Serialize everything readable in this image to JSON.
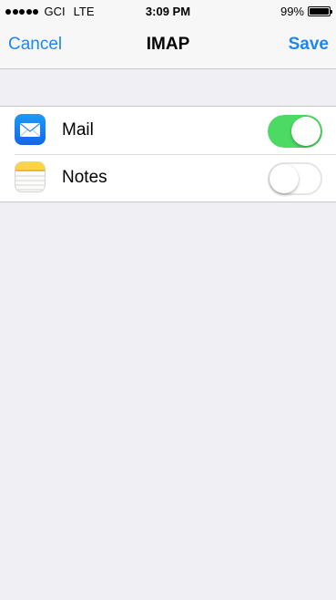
{
  "status_bar": {
    "carrier": "GCI",
    "network": "LTE",
    "time": "3:09 PM",
    "battery": "99%"
  },
  "nav": {
    "cancel_label": "Cancel",
    "title": "IMAP",
    "save_label": "Save"
  },
  "rows": [
    {
      "label": "Mail",
      "icon": "mail-icon",
      "enabled": true
    },
    {
      "label": "Notes",
      "icon": "notes-icon",
      "enabled": false
    }
  ],
  "colors": {
    "accent": "#1d86f0",
    "toggle_on": "#4cd964",
    "background": "#efeff4"
  }
}
